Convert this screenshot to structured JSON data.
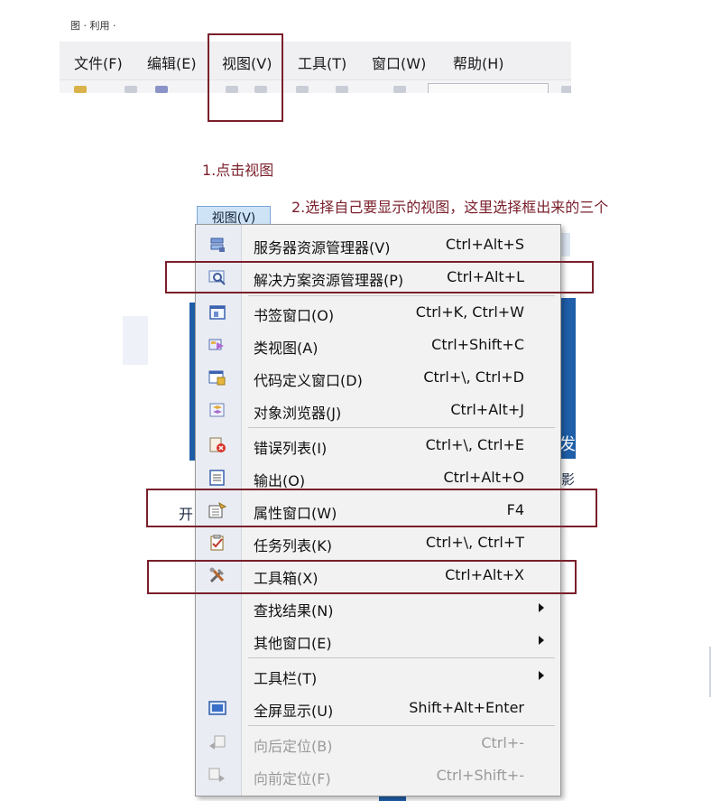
{
  "titlebar": {
    "fragment": "图 · 利用 ·"
  },
  "menubar": {
    "items": [
      "文件(F)",
      "编辑(E)",
      "视图(V)",
      "工具(T)",
      "窗口(W)",
      "帮助(H)"
    ]
  },
  "annotations": {
    "step1": "1.点击视图",
    "step2": "2.选择自己要显示的视图，这里选择框出来的三个"
  },
  "menu_tab": {
    "label": "视图(V)"
  },
  "background_fragments": {
    "a": "发",
    "b": "影",
    "c": "开"
  },
  "dropdown": {
    "items": [
      {
        "label": "服务器资源管理器(V)",
        "shortcut": "Ctrl+Alt+S",
        "icon": "server-explorer-icon"
      },
      {
        "label": "解决方案资源管理器(P)",
        "shortcut": "Ctrl+Alt+L",
        "icon": "solution-explorer-icon"
      },
      {
        "label": "书签窗口(O)",
        "shortcut": "Ctrl+K, Ctrl+W",
        "icon": "bookmark-window-icon"
      },
      {
        "label": "类视图(A)",
        "shortcut": "Ctrl+Shift+C",
        "icon": "class-view-icon"
      },
      {
        "label": "代码定义窗口(D)",
        "shortcut": "Ctrl+\\, Ctrl+D",
        "icon": "code-definition-icon"
      },
      {
        "label": "对象浏览器(J)",
        "shortcut": "Ctrl+Alt+J",
        "icon": "object-browser-icon"
      },
      {
        "label": "错误列表(I)",
        "shortcut": "Ctrl+\\, Ctrl+E",
        "icon": "error-list-icon"
      },
      {
        "label": "输出(O)",
        "shortcut": "Ctrl+Alt+O",
        "icon": "output-icon"
      },
      {
        "label": "属性窗口(W)",
        "shortcut": "F4",
        "icon": "properties-window-icon"
      },
      {
        "label": "任务列表(K)",
        "shortcut": "Ctrl+\\, Ctrl+T",
        "icon": "task-list-icon"
      },
      {
        "label": "工具箱(X)",
        "shortcut": "Ctrl+Alt+X",
        "icon": "toolbox-icon"
      },
      {
        "label": "查找结果(N)",
        "shortcut": "",
        "icon": ""
      },
      {
        "label": "其他窗口(E)",
        "shortcut": "",
        "icon": ""
      },
      {
        "label": "工具栏(T)",
        "shortcut": "",
        "icon": ""
      },
      {
        "label": "全屏显示(U)",
        "shortcut": "Shift+Alt+Enter",
        "icon": "full-screen-icon"
      },
      {
        "label": "向后定位(B)",
        "shortcut": "Ctrl+-",
        "icon": "navigate-backward-icon",
        "disabled": true
      },
      {
        "label": "向前定位(F)",
        "shortcut": "Ctrl+Shift+-",
        "icon": "navigate-forward-icon",
        "disabled": true
      }
    ]
  },
  "colors": {
    "highlight_border": "#7a1f2b",
    "annotation_text": "#7a1f2b",
    "ide_blue": "#1f5ea8",
    "menu_background": "#f2f2f2"
  }
}
